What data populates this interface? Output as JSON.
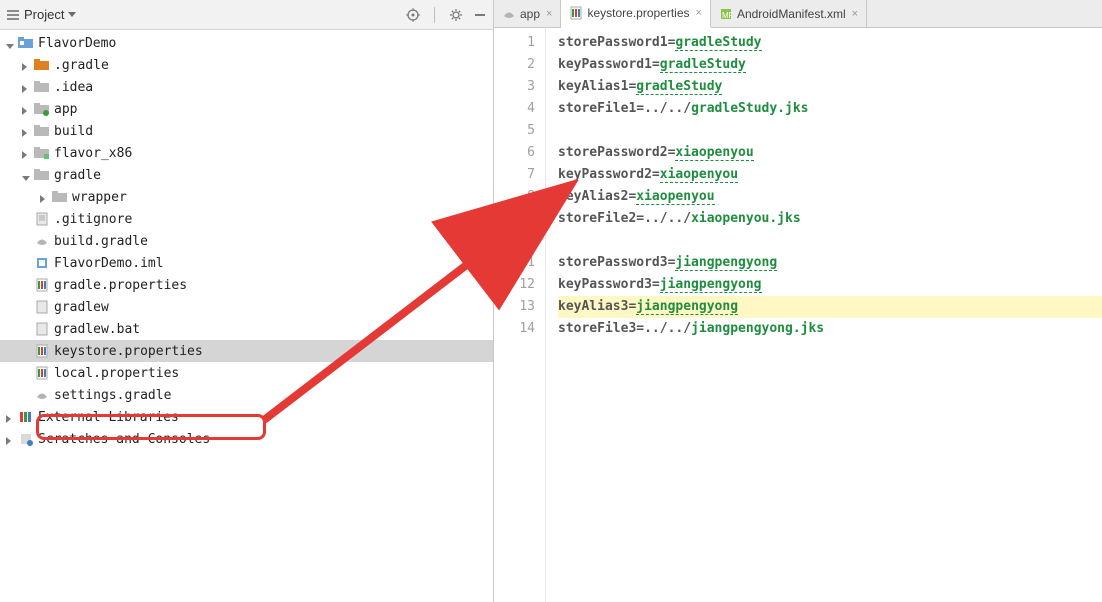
{
  "projectHeader": {
    "label": "Project"
  },
  "tree": {
    "root": "FlavorDemo",
    "items": [
      {
        "label": ".gradle"
      },
      {
        "label": ".idea"
      },
      {
        "label": "app"
      },
      {
        "label": "build"
      },
      {
        "label": "flavor_x86"
      },
      {
        "label": "gradle"
      },
      {
        "label": "wrapper"
      },
      {
        "label": ".gitignore"
      },
      {
        "label": "build.gradle"
      },
      {
        "label": "FlavorDemo.iml"
      },
      {
        "label": "gradle.properties"
      },
      {
        "label": "gradlew"
      },
      {
        "label": "gradlew.bat"
      },
      {
        "label": "keystore.properties"
      },
      {
        "label": "local.properties"
      },
      {
        "label": "settings.gradle"
      }
    ],
    "extLib": "External Libraries",
    "scratches": "Scratches and Consoles"
  },
  "tabs": [
    {
      "label": "app"
    },
    {
      "label": "keystore.properties"
    },
    {
      "label": "AndroidManifest.xml"
    }
  ],
  "code": [
    {
      "key": "storePassword1",
      "val": "gradleStudy",
      "type": "val"
    },
    {
      "key": "keyPassword1",
      "val": "gradleStudy",
      "type": "val"
    },
    {
      "key": "keyAlias1",
      "val": "gradleStudy",
      "type": "val"
    },
    {
      "key": "storeFile1",
      "val": "../../gradleStudy.jks",
      "type": "path",
      "pval": "gradleStudy.jks",
      "pre": "../../"
    },
    {
      "blank": true
    },
    {
      "key": "storePassword2",
      "val": "xiaopenyou",
      "type": "val"
    },
    {
      "key": "keyPassword2",
      "val": "xiaopenyou",
      "type": "val"
    },
    {
      "key": "keyAlias2",
      "val": "xiaopenyou",
      "type": "val"
    },
    {
      "key": "storeFile2",
      "val": "../../xiaopenyou.jks",
      "type": "path",
      "pval": "xiaopenyou.jks",
      "pre": "../../"
    },
    {
      "blank": true
    },
    {
      "key": "storePassword3",
      "val": "jiangpengyong",
      "type": "val"
    },
    {
      "key": "keyPassword3",
      "val": "jiangpengyong",
      "type": "val"
    },
    {
      "key": "keyAlias3",
      "val": "jiangpengyong",
      "type": "val",
      "hl": true
    },
    {
      "key": "storeFile3",
      "val": "../../jiangpengyong.jks",
      "type": "path",
      "pval": "jiangpengyong.jks",
      "pre": "../../"
    }
  ]
}
